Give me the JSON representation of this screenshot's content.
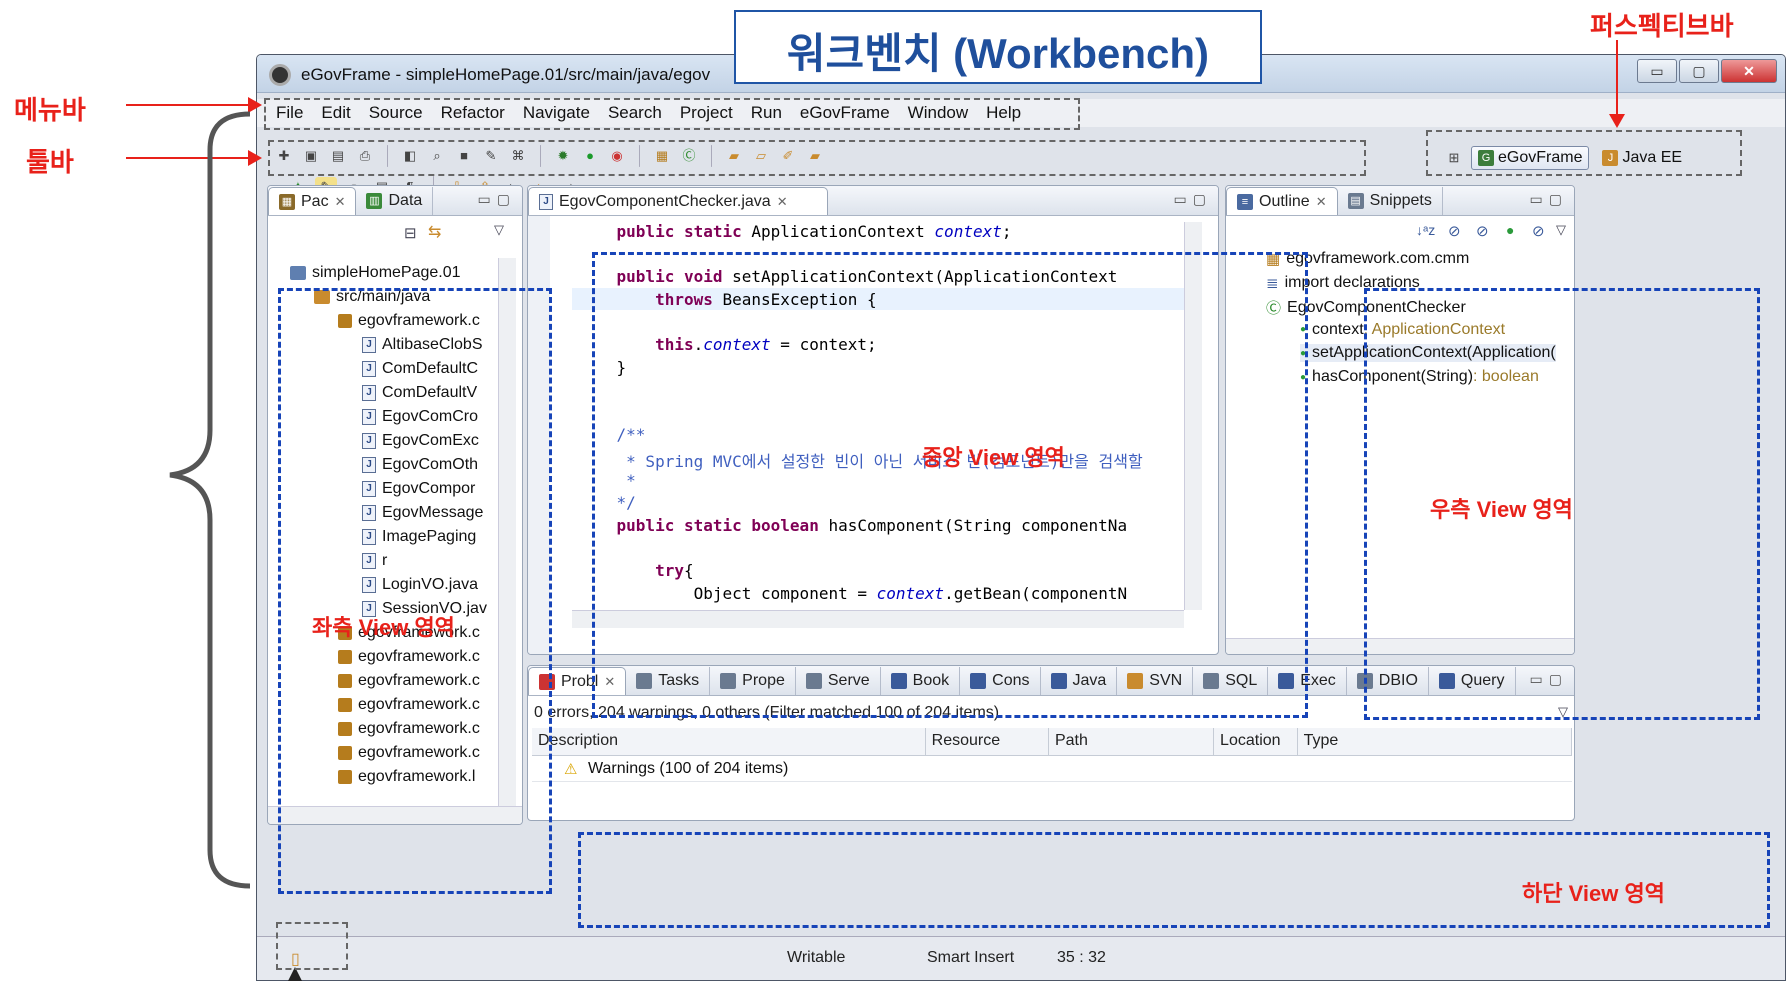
{
  "annotations": {
    "workbench_title": "워크벤치 (Workbench)",
    "perspective": "퍼스펙티브바",
    "menubar": "메뉴바",
    "toolbar": "툴바",
    "left_view": "좌측 View 영역",
    "center_view": "중앙 View 영역",
    "right_view": "우측 View 영역",
    "bottom_view": "하단 View 영역"
  },
  "window": {
    "title": "eGovFrame - simpleHomePage.01/src/main/java/egov"
  },
  "menu": [
    "File",
    "Edit",
    "Source",
    "Refactor",
    "Navigate",
    "Search",
    "Project",
    "Run",
    "eGovFrame",
    "Window",
    "Help"
  ],
  "perspectives": {
    "egov": "eGovFrame",
    "javaee": "Java EE"
  },
  "left_panel": {
    "tabs": [
      "Pac",
      "Data"
    ],
    "tree": [
      {
        "label": "simpleHomePage.01",
        "type": "project"
      },
      {
        "label": "src/main/java",
        "type": "srcfolder"
      },
      {
        "label": "egovframework.c",
        "type": "package"
      },
      {
        "label": "AltibaseClobS",
        "type": "java"
      },
      {
        "label": "ComDefaultC",
        "type": "java"
      },
      {
        "label": "ComDefaultV",
        "type": "java"
      },
      {
        "label": "EgovComCro",
        "type": "java"
      },
      {
        "label": "EgovComExc",
        "type": "java"
      },
      {
        "label": "EgovComOth",
        "type": "java"
      },
      {
        "label": "EgovCompor",
        "type": "java"
      },
      {
        "label": "EgovMessage",
        "type": "java"
      },
      {
        "label": "ImagePaging",
        "type": "java"
      },
      {
        "label": "r",
        "type": "java"
      },
      {
        "label": "LoginVO.java",
        "type": "java"
      },
      {
        "label": "SessionVO.jav",
        "type": "java"
      },
      {
        "label": "egovframework.c",
        "type": "package"
      },
      {
        "label": "egovframework.c",
        "type": "package"
      },
      {
        "label": "egovframework.c",
        "type": "package"
      },
      {
        "label": "egovframework.c",
        "type": "package"
      },
      {
        "label": "egovframework.c",
        "type": "package"
      },
      {
        "label": "egovframework.c",
        "type": "package"
      },
      {
        "label": "egovframework.l",
        "type": "package"
      }
    ]
  },
  "editor": {
    "tab": "EgovComponentChecker.java",
    "lines": [
      {
        "parts": [
          [
            "    ",
            ""
          ],
          [
            "public static ",
            "kw"
          ],
          [
            "ApplicationContext ",
            ""
          ],
          [
            "context",
            "fld"
          ],
          [
            ";",
            ""
          ]
        ]
      },
      {
        "parts": [
          [
            "",
            ""
          ]
        ]
      },
      {
        "parts": [
          [
            "    ",
            ""
          ],
          [
            "public void ",
            "kw"
          ],
          [
            "setApplicationContext(ApplicationContext",
            ""
          ]
        ]
      },
      {
        "parts": [
          [
            "        ",
            ""
          ],
          [
            "throws ",
            "kw"
          ],
          [
            "BeansException {",
            ""
          ]
        ]
      },
      {
        "parts": [
          [
            "",
            ""
          ]
        ]
      },
      {
        "parts": [
          [
            "        ",
            ""
          ],
          [
            "this",
            "kw"
          ],
          [
            ".",
            ""
          ],
          [
            "context",
            "fld"
          ],
          [
            " = context;",
            ""
          ]
        ]
      },
      {
        "parts": [
          [
            "    }",
            ""
          ]
        ]
      },
      {
        "parts": [
          [
            "",
            ""
          ]
        ]
      },
      {
        "parts": [
          [
            "",
            ""
          ]
        ]
      },
      {
        "parts": [
          [
            "    /**",
            "cmt"
          ]
        ]
      },
      {
        "parts": [
          [
            "     * Spring MVC에서 설정한 빈이 아닌 서비스 빈(컴포넌트)만을 검색할",
            "cmt"
          ]
        ]
      },
      {
        "parts": [
          [
            "     *",
            "cmt"
          ]
        ]
      },
      {
        "parts": [
          [
            "    */",
            "cmt"
          ]
        ]
      },
      {
        "parts": [
          [
            "    ",
            ""
          ],
          [
            "public static boolean ",
            "kw"
          ],
          [
            "hasComponent(String componentNa",
            ""
          ]
        ]
      },
      {
        "parts": [
          [
            "",
            ""
          ]
        ]
      },
      {
        "parts": [
          [
            "        ",
            ""
          ],
          [
            "try",
            "kw"
          ],
          [
            "{",
            ""
          ]
        ]
      },
      {
        "parts": [
          [
            "            Object component = ",
            ""
          ],
          [
            "context",
            "fld"
          ],
          [
            ".getBean(componentN",
            ""
          ]
        ]
      }
    ]
  },
  "outline": {
    "tabs": [
      "Outline",
      "Snippets"
    ],
    "items": [
      {
        "label": "egovframework.com.cmm",
        "type": ""
      },
      {
        "label": "import declarations",
        "type": ""
      },
      {
        "label": "EgovComponentChecker",
        "type": ""
      },
      {
        "label": "context",
        "type": " : ApplicationContext"
      },
      {
        "label": "setApplicationContext(Application(",
        "type": ""
      },
      {
        "label": "hasComponent(String)",
        "type": " : boolean"
      }
    ]
  },
  "bottom": {
    "tabs": [
      "Probl",
      "Tasks",
      "Prope",
      "Serve",
      "Book",
      "Cons",
      "Java",
      "SVN",
      "SQL",
      "Exec",
      "DBIO",
      "Query"
    ],
    "summary": "0 errors, 204 warnings, 0 others (Filter matched 100 of 204 items)",
    "columns": [
      "Description",
      "Resource",
      "Path",
      "Location",
      "Type"
    ],
    "row": "Warnings (100 of 204 items)"
  },
  "status": {
    "writable": "Writable",
    "insert": "Smart Insert",
    "position": "35 : 32"
  },
  "colors": {
    "annotation_red": "#e8211a",
    "annotation_blue": "#1744b8",
    "keyword": "#7f0055",
    "field": "#0000c0",
    "comment": "#3f5fbf"
  }
}
